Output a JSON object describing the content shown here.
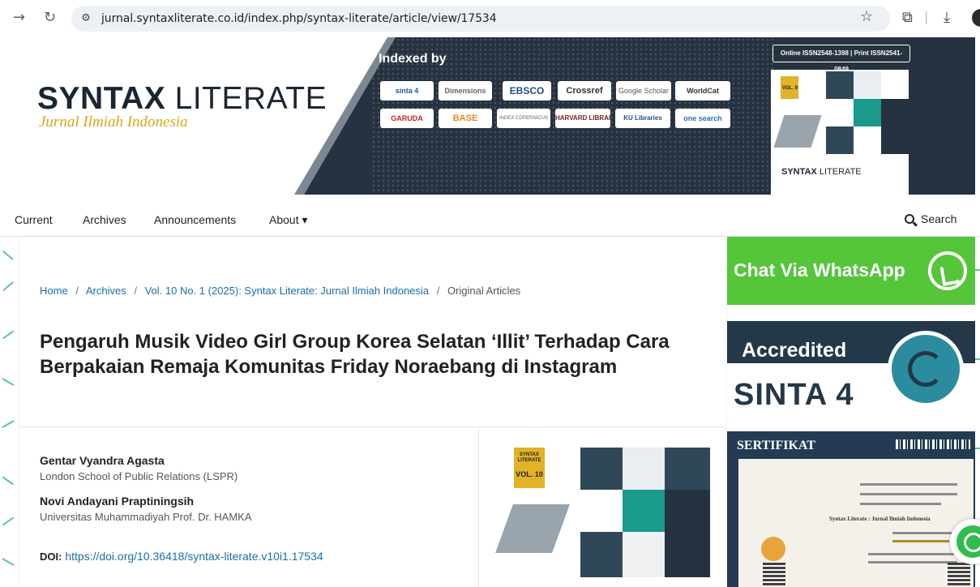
{
  "browser": {
    "back_glyph": "→",
    "reload_glyph": "↻",
    "url": "jurnal.syntaxliterate.co.id/index.php/syntax-literate/article/view/17534",
    "star_glyph": "☆",
    "extensions_glyph": "⧉",
    "download_glyph": "⤓"
  },
  "header": {
    "logo_title_bold": "SYNTAX",
    "logo_title_rest": " LITERATE",
    "logo_subtitle": "Jurnal Ilmiah Indonesia",
    "indexed_by": "Indexed by",
    "indexers_row1": [
      "sinta 4",
      "Dimensions",
      "EBSCO",
      "Crossref",
      "Google Scholar",
      "WorldCat"
    ],
    "indexers_row2": [
      "GARUDA",
      "BASE",
      "INDEX COPERNICUS",
      "HARVARD LIBRARY",
      "KU Libraries",
      "one search"
    ],
    "issn": "Online ISSN2548-1398 | Print ISSN2541-0849",
    "cover_title_bold": "SYNTAX",
    "cover_title_rest": " LITERATE",
    "cover_badge": "VOL. 9",
    "colors": {
      "banner_bg": "#263240",
      "logo_subtitle": "#d6a71a"
    }
  },
  "menu": {
    "items": [
      "Current",
      "Archives",
      "Announcements",
      "About ▾"
    ],
    "search_label": "Search"
  },
  "breadcrumb": {
    "home": "Home",
    "archives": "Archives",
    "issue": "Vol. 10 No. 1 (2025): Syntax Literate: Jurnal Ilmiah Indonesia",
    "section": "Original Articles",
    "separator": "/"
  },
  "article": {
    "title": "Pengaruh Musik Video Girl Group Korea Selatan ‘Illit’ Terhadap Cara Berpakaian Remaja Komunitas Friday Noraebang di Instagram",
    "authors": [
      {
        "name": "Gentar Vyandra Agasta",
        "affiliation": "London School of Public Relations (LSPR)"
      },
      {
        "name": "Novi Andayani Praptiningsih",
        "affiliation": "Universitas Muhammadiyah Prof. Dr. HAMKA"
      }
    ],
    "doi_label": "DOI:",
    "doi_url": "https://doi.org/10.36418/syntax-literate.v10i1.17534",
    "cover_badge_line1": "SYNTAX LITERATE",
    "cover_badge_line2": "VOL. 10"
  },
  "sidebar": {
    "whatsapp_text": "Chat Via WhatsApp",
    "accredited_text": "Accredited",
    "sinta_text": "SINTA 4",
    "certificate_title": "SERTIFIKAT",
    "certificate_journal": "Syntax Literate : Jurnal Ilmiah Indonesia",
    "colors": {
      "whatsapp_green": "#55c53a",
      "sinta_navy": "#233848"
    }
  }
}
